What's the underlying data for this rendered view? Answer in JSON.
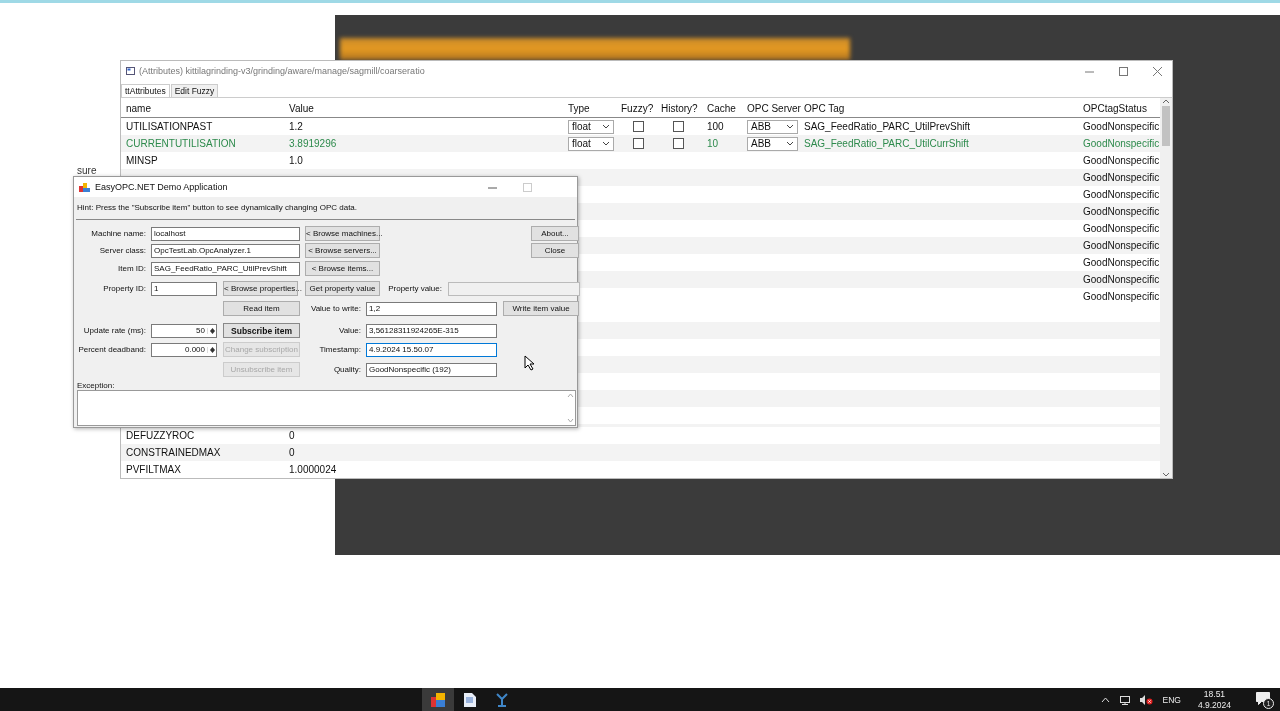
{
  "attributes_window": {
    "title": "(Attributes) kittilagrinding-v3/grinding/aware/manage/sagmill/coarseratio",
    "tabs": [
      {
        "label": "ttAttributes",
        "selected": true
      },
      {
        "label": "Edit Fuzzy",
        "selected": false
      }
    ],
    "columns": [
      "name",
      "Value",
      "Type",
      "Fuzzy?",
      "History?",
      "Cache",
      "OPC Server",
      "OPC Tag",
      "OPCtagStatus"
    ],
    "rows": [
      {
        "name": "UTILISATIONPAST",
        "value": "1.2",
        "type": "float",
        "fuzzy": false,
        "history": false,
        "cache": "100",
        "opc_server": "ABB",
        "opc_tag": "SAG_FeedRatio_PARC_UtilPrevShift",
        "status": "GoodNonspecific",
        "highlighted": false
      },
      {
        "name": "CURRENTUTILISATION",
        "value": "3.8919296",
        "type": "float",
        "fuzzy": false,
        "history": false,
        "cache": "10",
        "opc_server": "ABB",
        "opc_tag": "SAG_FeedRatio_PARC_UtilCurrShift",
        "status": "GoodNonspecific",
        "highlighted": true
      },
      {
        "name": "MINSP",
        "value": "1.0",
        "status": "GoodNonspecific",
        "highlighted": false
      },
      {
        "status": "GoodNonspecific",
        "highlighted": false
      },
      {
        "status": "GoodNonspecific",
        "highlighted": false
      },
      {
        "status": "GoodNonspecific",
        "highlighted": false
      },
      {
        "status": "GoodNonspecific",
        "highlighted": false
      },
      {
        "status": "GoodNonspecific",
        "highlighted": false
      },
      {
        "status": "GoodNonspecific",
        "highlighted": false
      },
      {
        "status": "GoodNonspecific",
        "highlighted": false
      },
      {
        "status": "GoodNonspecific",
        "highlighted": false
      }
    ],
    "rows_below": [
      {
        "name": "DEFUZZYROC",
        "value": "0",
        "highlighted": false
      },
      {
        "name": "CONSTRAINEDMAX",
        "value": "0",
        "highlighted": false
      },
      {
        "name": "PVFILTMAX",
        "value": "1.0000024",
        "highlighted": false
      }
    ]
  },
  "desktop_fragment": "sure",
  "dialog": {
    "title": "EasyOPC.NET Demo Application",
    "hint": "Hint: Press the \"Subscribe item\" button to see dynamically changing OPC data.",
    "rows": [
      [
        {
          "kind": "label",
          "text": "Machine name:"
        },
        {
          "kind": "field",
          "value": "localhost",
          "disabled": false,
          "focused": false
        },
        {
          "kind": "button",
          "text": "< Browse machines...",
          "disabled": false,
          "default": false
        },
        {
          "kind": "button",
          "text": "About...",
          "disabled": false,
          "default": false
        }
      ],
      [
        {
          "kind": "label",
          "text": "Server class:"
        },
        {
          "kind": "field",
          "value": "OpcTestLab.OpcAnalyzer.1",
          "disabled": false,
          "focused": false
        },
        {
          "kind": "button",
          "text": "< Browse servers...",
          "disabled": false,
          "default": false
        },
        {
          "kind": "button",
          "text": "Close",
          "disabled": false,
          "default": false
        }
      ],
      [
        {
          "kind": "label",
          "text": "Item ID:"
        },
        {
          "kind": "field",
          "value": "SAG_FeedRatio_PARC_UtilPrevShift",
          "disabled": false,
          "focused": false
        },
        {
          "kind": "button",
          "text": "< Browse items...",
          "disabled": false,
          "default": false
        }
      ],
      [
        {
          "kind": "label",
          "text": "Property ID:"
        },
        {
          "kind": "field",
          "value": "1",
          "disabled": false,
          "focused": false
        },
        {
          "kind": "button",
          "text": "< Browse properties...",
          "disabled": false,
          "default": false
        },
        {
          "kind": "button",
          "text": "Get property value",
          "disabled": false,
          "default": false
        },
        {
          "kind": "label",
          "text": "Property value:"
        },
        {
          "kind": "field",
          "disabled": true,
          "focused": false
        }
      ],
      [
        {
          "kind": "button",
          "text": "Read item",
          "disabled": false,
          "default": false
        },
        {
          "kind": "label",
          "text": "Value to write:"
        },
        {
          "kind": "field",
          "value": "1,2",
          "disabled": false,
          "focused": false
        },
        {
          "kind": "button",
          "text": "Write item value",
          "disabled": false,
          "default": false
        }
      ],
      [
        {
          "kind": "label",
          "text": "Update rate (ms):"
        },
        {
          "kind": "spinner",
          "value": "50"
        },
        {
          "kind": "button",
          "text": "Subscribe item",
          "disabled": false,
          "default": true
        },
        {
          "kind": "label",
          "text": "Value:"
        },
        {
          "kind": "field",
          "value": "3,56128311924265E-315",
          "disabled": false,
          "focused": false
        }
      ],
      [
        {
          "kind": "label",
          "text": "Percent deadband:"
        },
        {
          "kind": "spinner",
          "value": "0.000"
        },
        {
          "kind": "button",
          "text": "Change subscription",
          "disabled": true,
          "default": false
        },
        {
          "kind": "label",
          "text": "Timestamp:"
        },
        {
          "kind": "field",
          "value": "4.9.2024 15.50.07",
          "disabled": false,
          "focused": true
        }
      ],
      [
        {
          "kind": "button",
          "text": "Unsubscribe item",
          "disabled": true,
          "default": false
        },
        {
          "kind": "label",
          "text": "Quality:"
        },
        {
          "kind": "field",
          "value": "GoodNonspecific (192)",
          "disabled": false,
          "focused": false
        }
      ]
    ],
    "exception_label": "Exception:"
  },
  "taskbar": {
    "language": "ENG",
    "time": "18.51",
    "date": "4.9.2024",
    "notification_count": "1"
  }
}
